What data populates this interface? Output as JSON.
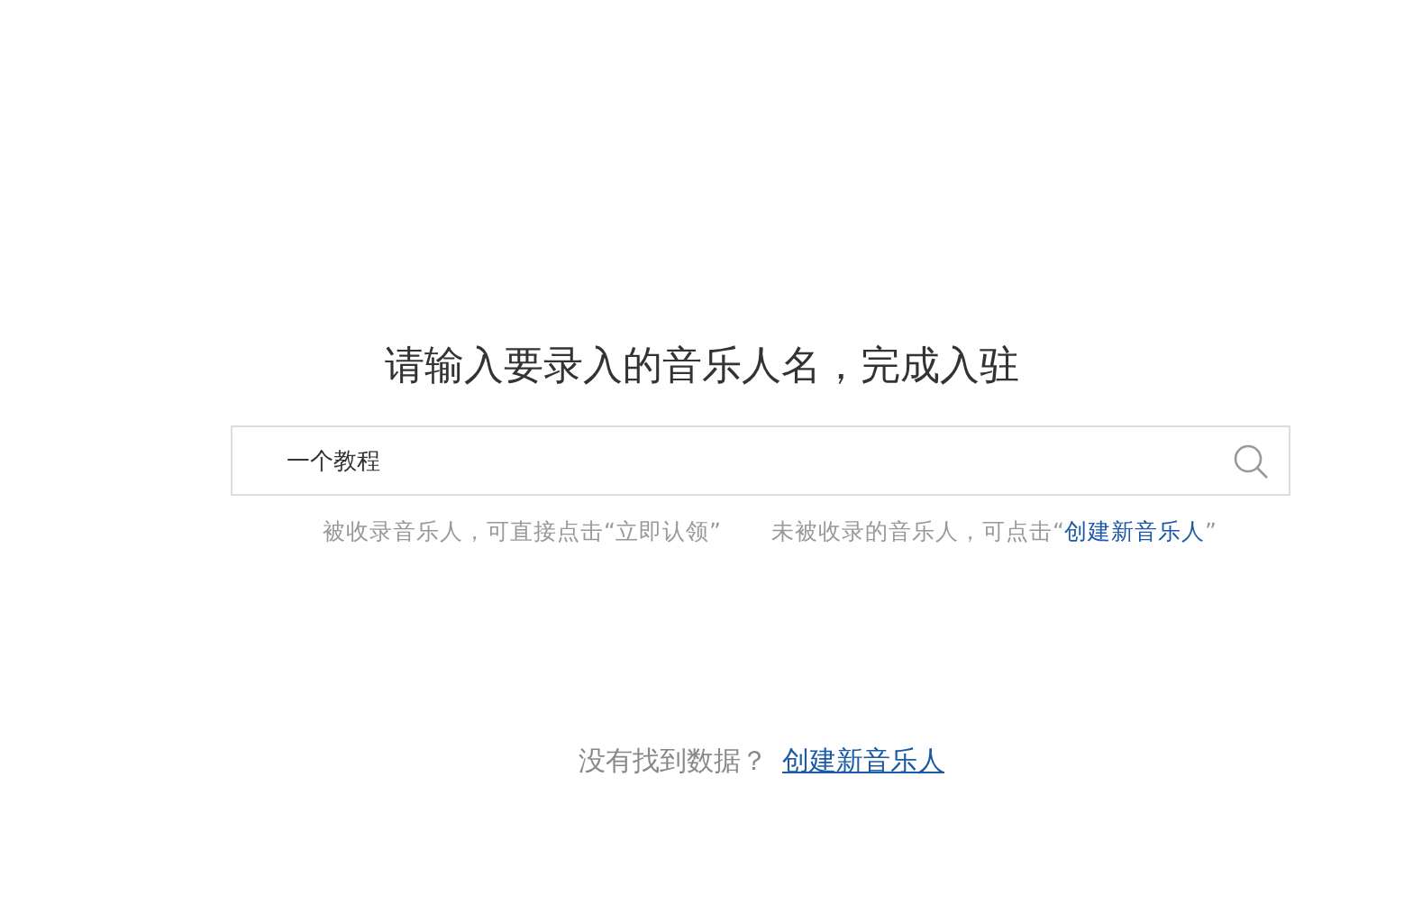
{
  "title": "请输入要录入的音乐人名，完成入驻",
  "search": {
    "value": "一个教程"
  },
  "hints": {
    "claimed": "被收录音乐人，可直接点击“立即认领”",
    "unclaimed_before": "未被收录的音乐人，可点击“",
    "unclaimed_link": "创建新音乐人",
    "unclaimed_after": "”"
  },
  "empty": {
    "message": "没有找到数据？",
    "link": "创建新音乐人"
  }
}
